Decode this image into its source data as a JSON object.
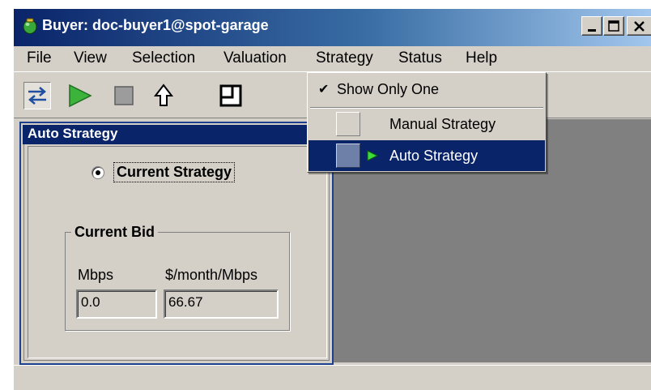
{
  "window": {
    "title": "Buyer: doc-buyer1@spot-garage"
  },
  "menubar": {
    "items": [
      "File",
      "View",
      "Selection",
      "Valuation",
      "Strategy",
      "Status",
      "Help"
    ]
  },
  "toolbar": {
    "icons": [
      "swap-arrows-icon",
      "play-icon",
      "stop-icon",
      "up-arrow-icon",
      "window-icon"
    ]
  },
  "auto_strategy_frame": {
    "title": "Auto Strategy",
    "radio_label": "Current Strategy",
    "radio_selected": true,
    "group_title": "Current Bid",
    "mbps_label": "Mbps",
    "price_label": "$/month/Mbps",
    "mbps_value": "0.0",
    "price_value": "66.67"
  },
  "strategy_menu": {
    "show_only_one": "Show Only One",
    "show_only_one_checked": true,
    "check_mark": "✔",
    "manual": "Manual Strategy",
    "auto": "Auto Strategy"
  },
  "colors": {
    "title_bar": "#0a246a",
    "highlight": "#0a246a",
    "desktop": "#808080",
    "face": "#d4d0c8",
    "play_green": "#3cb43c"
  }
}
